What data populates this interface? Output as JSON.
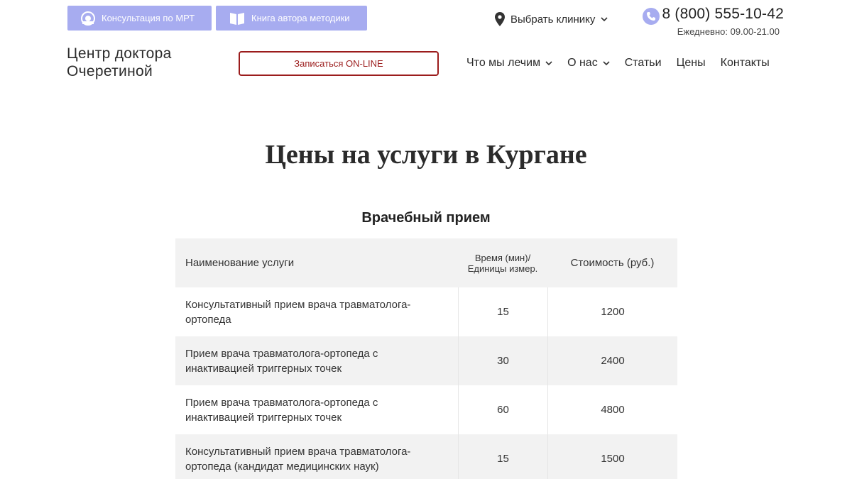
{
  "header": {
    "buttons": [
      {
        "label": "Консультация по МРТ",
        "icon": "mri-icon"
      },
      {
        "label": "Книга автора методики",
        "icon": "book-icon"
      }
    ],
    "clinic_select": "Выбрать клинику",
    "phone": "8 (800) 555-10-42",
    "hours": "Ежедневно: 09.00-21.00",
    "logo_line1": "Центр доктора",
    "logo_line2": "Очеретиной",
    "online_button": "Записаться ON-LINE",
    "nav": [
      {
        "label": "Что мы лечим",
        "dropdown": true
      },
      {
        "label": "О нас",
        "dropdown": true
      },
      {
        "label": "Статьи",
        "dropdown": false
      },
      {
        "label": "Цены",
        "dropdown": false
      },
      {
        "label": "Контакты",
        "dropdown": false
      }
    ]
  },
  "page": {
    "title": "Цены на услуги в Кургане",
    "section_title": "Врачебный прием"
  },
  "table": {
    "columns": [
      "Наименование услуги",
      "Время (мин)/ Единицы измер.",
      "Стоимость (руб.)"
    ],
    "rows": [
      {
        "name": "Консультативный прием врача травматолога-ортопеда",
        "time": "15",
        "price": "1200"
      },
      {
        "name": "Прием врача травматолога-ортопеда с инактивацией триггерных точек",
        "time": "30",
        "price": "2400"
      },
      {
        "name": "Прием врача травматолога-ортопеда с инактивацией триггерных точек",
        "time": "60",
        "price": "4800"
      },
      {
        "name": "Консультативный прием врача травматолога-ортопеда (кандидат медицинских наук)",
        "time": "15",
        "price": "1500"
      }
    ]
  },
  "colors": {
    "accent": "#a7acf0",
    "cta_border": "#9b1c1c",
    "table_shade": "#f2f2f2"
  }
}
